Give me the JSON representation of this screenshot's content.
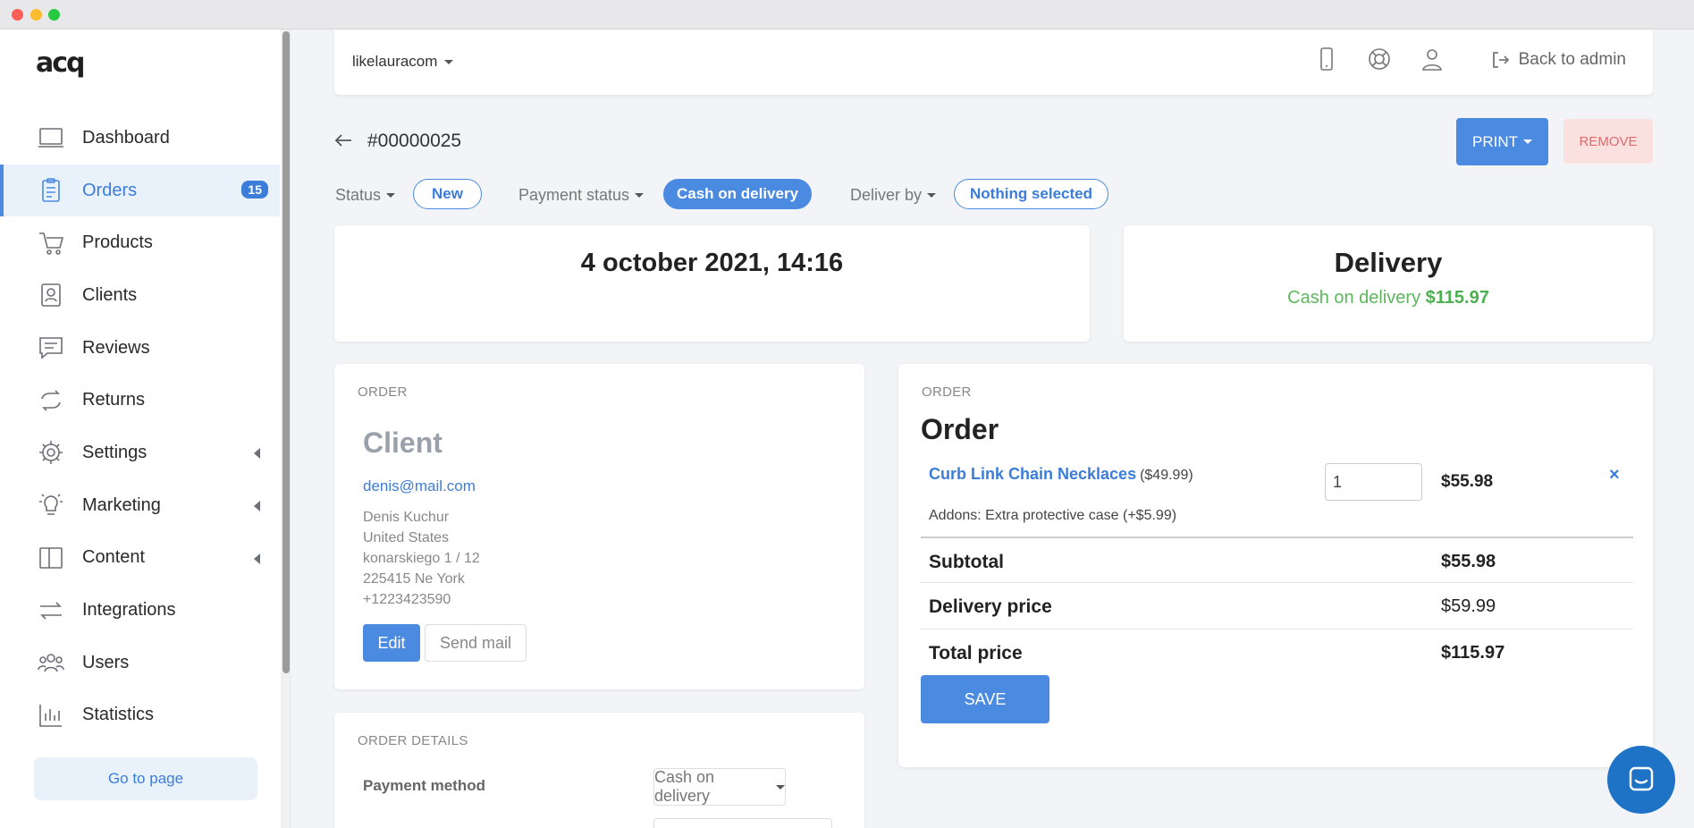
{
  "window": {
    "controls": [
      "close",
      "minimize",
      "maximize"
    ]
  },
  "sidebar": {
    "logo": "acq",
    "items": [
      {
        "label": "Dashboard",
        "icon": "dashboard-icon"
      },
      {
        "label": "Orders",
        "icon": "clipboard-icon",
        "badge": "15",
        "active": true
      },
      {
        "label": "Products",
        "icon": "cart-icon"
      },
      {
        "label": "Clients",
        "icon": "contacts-icon"
      },
      {
        "label": "Reviews",
        "icon": "chat-icon"
      },
      {
        "label": "Returns",
        "icon": "repeat-icon"
      },
      {
        "label": "Settings",
        "icon": "gear-icon",
        "expandable": true
      },
      {
        "label": "Marketing",
        "icon": "lightbulb-icon",
        "expandable": true
      },
      {
        "label": "Content",
        "icon": "layout-icon",
        "expandable": true
      },
      {
        "label": "Integrations",
        "icon": "arrows-icon"
      },
      {
        "label": "Users",
        "icon": "users-icon"
      },
      {
        "label": "Statistics",
        "icon": "bar-chart-icon"
      }
    ],
    "goto_label": "Go to page"
  },
  "topbar": {
    "store": "likelauracom",
    "back_admin": "Back to admin"
  },
  "order": {
    "number": "#00000025",
    "print_label": "PRINT",
    "remove_label": "REMOVE",
    "status_label": "Status",
    "status_value": "New",
    "payment_status_label": "Payment status",
    "payment_status_value": "Cash on delivery",
    "deliver_by_label": "Deliver by",
    "deliver_by_value": "Nothing selected",
    "date": "4 october 2021, 14:16",
    "delivery_title": "Delivery",
    "delivery_method": "Cash on delivery",
    "delivery_amount": "$115.97"
  },
  "client": {
    "tag": "ORDER",
    "title": "Client",
    "email": "denis@mail.com",
    "name": "Denis Kuchur",
    "country": "United States",
    "street": "konarskiego 1 / 12",
    "city": "225415 Ne York",
    "phone": "+1223423590",
    "edit_label": "Edit",
    "mail_label": "Send mail"
  },
  "details": {
    "tag": "ORDER DETAILS",
    "payment_method_label": "Payment method",
    "payment_method_value": "Cash on delivery"
  },
  "order_panel": {
    "tag": "ORDER",
    "title": "Order",
    "product_name": "Curb Link Chain Necklaces",
    "product_price": "($49.99)",
    "quantity": "1",
    "line_total": "$55.98",
    "remove_glyph": "×",
    "addons": "Addons: Extra protective case (+$5.99)",
    "subtotal_label": "Subtotal",
    "subtotal_value": "$55.98",
    "delivery_label": "Delivery price",
    "delivery_value": "$59.99",
    "total_label": "Total price",
    "total_value": "$115.97",
    "save_label": "SAVE"
  },
  "colors": {
    "accent": "#4a8ae0",
    "success": "#4caf50",
    "danger_bg": "#fbe0e0",
    "danger_text": "#e06a6a",
    "chat": "#1f73c7"
  }
}
